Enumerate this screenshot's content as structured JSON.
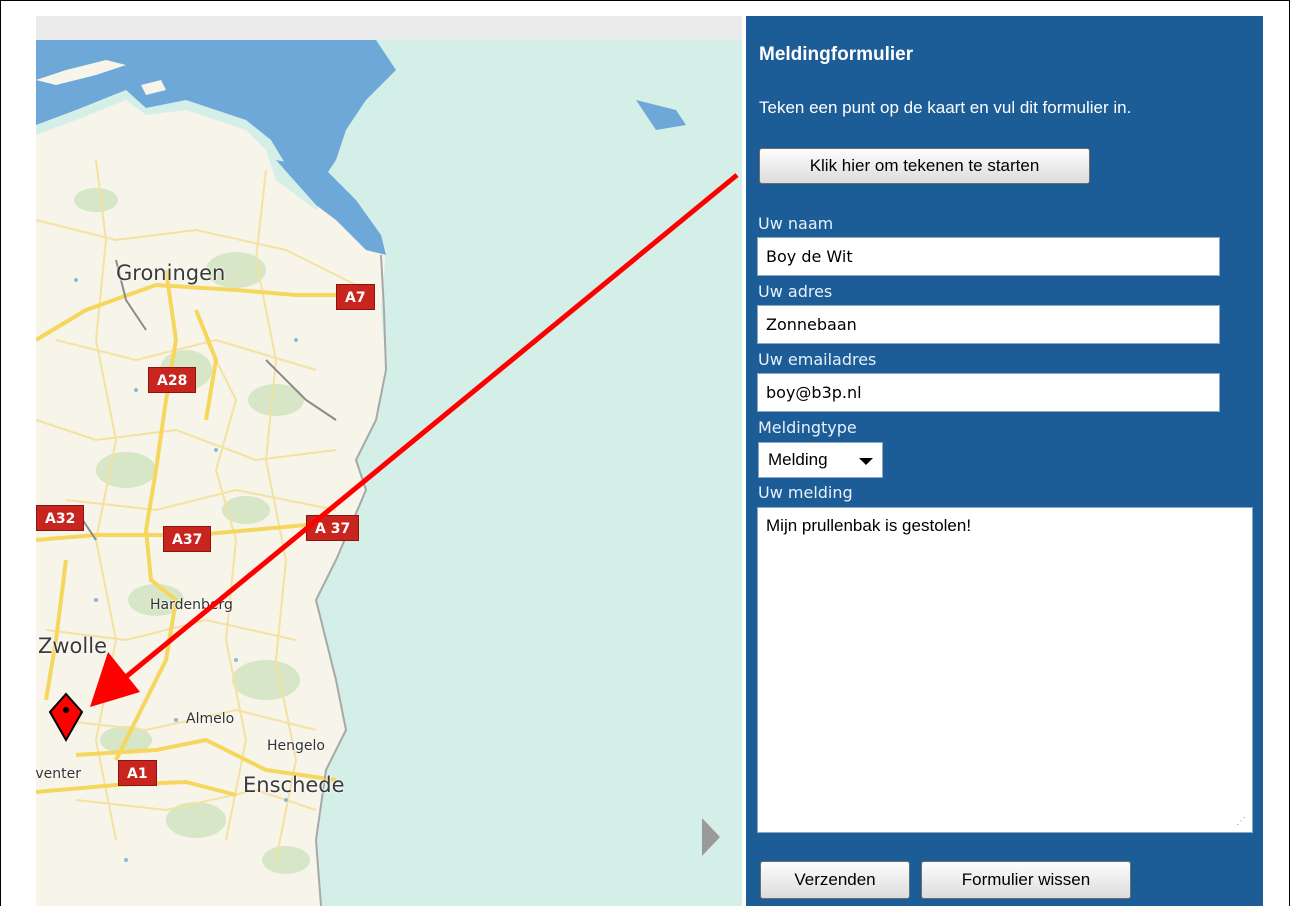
{
  "map": {
    "places": [
      "Groningen",
      "Zwolle",
      "Hardenberg",
      "Almelo",
      "Hengelo",
      "Deventer",
      "Enschede"
    ],
    "roads": [
      "A7",
      "A28",
      "A32",
      "A37",
      "A 37",
      "A1"
    ],
    "next_icon": "chevron-right-icon",
    "marker_icon": "map-pin-icon"
  },
  "panel": {
    "title": "Meldingformulier",
    "instructions": "Teken een punt op de kaart en vul dit formulier in.",
    "start_button": "Klik hier om tekenen te starten",
    "name_label": "Uw naam",
    "name_value": "Boy de Wit",
    "address_label": "Uw adres",
    "address_value": "Zonnebaan",
    "email_label": "Uw emailadres",
    "email_value": "boy@b3p.nl",
    "type_label": "Meldingtype",
    "type_value": "Melding",
    "message_label": "Uw melding",
    "message_value": "Mijn prullenbak is gestolen!",
    "submit_button": "Verzenden",
    "clear_button": "Formulier wissen"
  },
  "colors": {
    "panel_bg": "#1c5d98",
    "sea": "#6ea8d8",
    "land": "#f7f4ea",
    "road": "#f5d75e",
    "motorway_shield": "#c8251f",
    "annotation_arrow": "#ff0000"
  }
}
